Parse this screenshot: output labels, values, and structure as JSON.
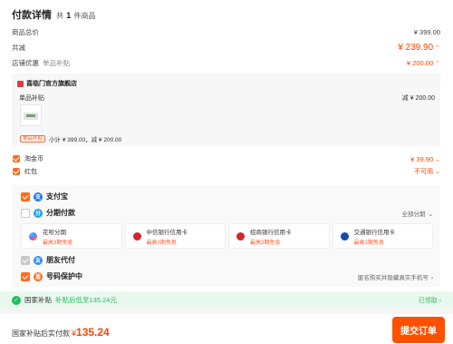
{
  "header": {
    "title": "付款详情",
    "count_prefix": "共",
    "count": "1",
    "count_suffix": "件商品"
  },
  "summary": {
    "goods_total_label": "商品总价",
    "goods_total_value": "¥ 399.00",
    "discount_label": "共减",
    "discount_value": "¥ 239.90",
    "shop_discount_label": "店铺优惠",
    "shop_discount_sub": "单品补贴",
    "shop_discount_value": "¥ 200.00"
  },
  "shop": {
    "name": "喜临门官方旗舰店",
    "product_label": "单品补贴",
    "product_discount": "减 ¥ 200.00",
    "tag": "单品补贴",
    "line_text": "小计 ¥ 399.00，减 ¥ 200.00"
  },
  "options": {
    "taojinbi_label": "淘金币",
    "taojinbi_value": "¥ 39.90",
    "hongbao_label": "红包",
    "hongbao_value": "不可用"
  },
  "payment": {
    "alipay": "支付宝",
    "installment": "分期付款",
    "installment_right": "全部分期",
    "cards": [
      {
        "name": "花呗分期",
        "sub": "最高3期免息",
        "color": "#4a8cff"
      },
      {
        "name": "中信银行信用卡",
        "sub": "最高3期免息",
        "color": "#d3252a"
      },
      {
        "name": "招商银行信用卡",
        "sub": "最高3期免息",
        "color": "#d3252a"
      },
      {
        "name": "交通银行信用卡",
        "sub": "最高3期免息",
        "color": "#1a4aa8"
      }
    ],
    "friend_pay": "朋友代付",
    "number_protect": "号码保护中",
    "number_protect_right": "匿名购买并隐藏真实手机号"
  },
  "subsidy": {
    "label": "国家补贴",
    "highlight": "补贴后低至135.24元",
    "status": "已领取"
  },
  "footer": {
    "final_label": "国家补贴后实付款",
    "currency": "¥",
    "amount": "135.24",
    "submit_label": "提交订单"
  },
  "colors": {
    "accent": "#ff5000",
    "price_red": "#ff4400",
    "green": "#1fbf5a"
  }
}
